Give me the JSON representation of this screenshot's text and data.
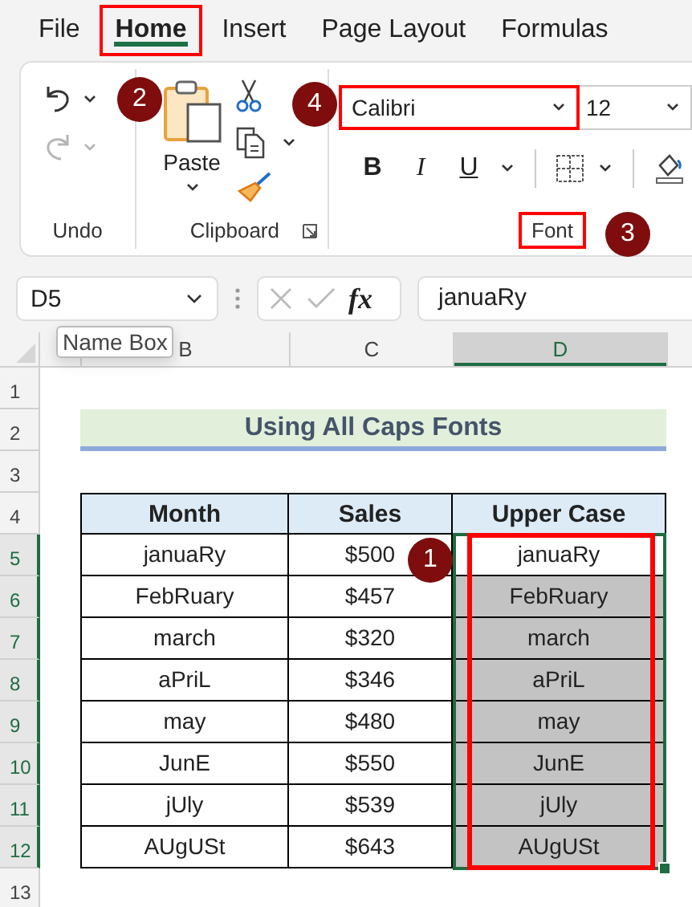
{
  "tabs": [
    {
      "label": "File",
      "selected": false,
      "outlined": false
    },
    {
      "label": "Home",
      "selected": true,
      "outlined": true
    },
    {
      "label": "Insert",
      "selected": false,
      "outlined": false
    },
    {
      "label": "Page Layout",
      "selected": false,
      "outlined": false
    },
    {
      "label": "Formulas",
      "selected": false,
      "outlined": false
    }
  ],
  "ribbon": {
    "undo": {
      "label": "Undo"
    },
    "clipboard": {
      "label": "Clipboard",
      "paste_label": "Paste"
    },
    "font": {
      "label": "Font",
      "label_outlined": true,
      "font_name": "Calibri",
      "name_outlined": true,
      "font_size": "12",
      "styles": [
        "B",
        "I",
        "U"
      ]
    }
  },
  "formula_bar": {
    "name_box": "D5",
    "fx": "fx",
    "formula": "januaRy"
  },
  "tooltip": "Name Box",
  "sheet": {
    "columns": [
      {
        "label": "B",
        "selected": false
      },
      {
        "label": "C",
        "selected": false
      },
      {
        "label": "D",
        "selected": true
      }
    ],
    "rows": [
      {
        "label": "1",
        "selected": false
      },
      {
        "label": "2",
        "selected": false
      },
      {
        "label": "3",
        "selected": false
      },
      {
        "label": "4",
        "selected": false
      },
      {
        "label": "5",
        "selected": true
      },
      {
        "label": "6",
        "selected": true
      },
      {
        "label": "7",
        "selected": true
      },
      {
        "label": "8",
        "selected": true
      },
      {
        "label": "9",
        "selected": true
      },
      {
        "label": "10",
        "selected": true
      },
      {
        "label": "11",
        "selected": true
      },
      {
        "label": "12",
        "selected": true
      },
      {
        "label": "13",
        "selected": false
      }
    ]
  },
  "title": "Using All Caps Fonts",
  "table": {
    "columns": [
      {
        "label": "Month",
        "selected": false,
        "outlined": false
      },
      {
        "label": "Sales",
        "selected": false,
        "outlined": false
      },
      {
        "label": "Upper Case",
        "selected": true,
        "outlined": true
      }
    ],
    "rows": [
      {
        "cells": [
          "januaRy",
          "$500",
          "januaRy"
        ],
        "active": true
      },
      {
        "cells": [
          "FebRuary",
          "$457",
          "FebRuary"
        ],
        "active": false
      },
      {
        "cells": [
          "march",
          "$320",
          "march"
        ],
        "active": false
      },
      {
        "cells": [
          "aPriL",
          "$346",
          "aPriL"
        ],
        "active": false
      },
      {
        "cells": [
          "may",
          "$480",
          "may"
        ],
        "active": false
      },
      {
        "cells": [
          "JunE",
          "$550",
          "JunE"
        ],
        "active": false
      },
      {
        "cells": [
          "jUly",
          "$539",
          "jUly"
        ],
        "active": false
      },
      {
        "cells": [
          "AUgUSt",
          "$643",
          "AUgUSt"
        ],
        "active": false
      }
    ]
  },
  "callouts": [
    {
      "number": "1"
    },
    {
      "number": "2"
    },
    {
      "number": "3"
    },
    {
      "number": "4"
    }
  ]
}
